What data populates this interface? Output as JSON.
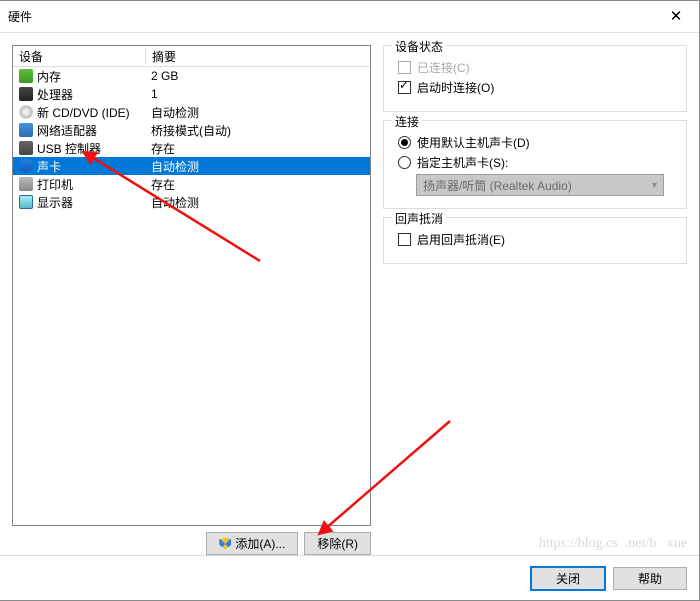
{
  "title": "硬件",
  "columns": {
    "device": "设备",
    "summary": "摘要"
  },
  "devices": [
    {
      "name": "内存",
      "summary": "2 GB",
      "icon": "icon-green",
      "selected": false
    },
    {
      "name": "处理器",
      "summary": "1",
      "icon": "icon-chip",
      "selected": false
    },
    {
      "name": "新 CD/DVD (IDE)",
      "summary": "自动检测",
      "icon": "icon-disc",
      "selected": false
    },
    {
      "name": "网络适配器",
      "summary": "桥接模式(自动)",
      "icon": "icon-net",
      "selected": false
    },
    {
      "name": "USB 控制器",
      "summary": "存在",
      "icon": "icon-usb",
      "selected": false
    },
    {
      "name": "声卡",
      "summary": "自动检测",
      "icon": "icon-sound",
      "selected": true
    },
    {
      "name": "打印机",
      "summary": "存在",
      "icon": "icon-printer",
      "selected": false
    },
    {
      "name": "显示器",
      "summary": "自动检测",
      "icon": "icon-monitor",
      "selected": false
    }
  ],
  "buttons": {
    "add": "添加(A)...",
    "remove": "移除(R)"
  },
  "groups": {
    "device_status": {
      "legend": "设备状态",
      "connected": {
        "label": "已连接(C)",
        "checked": false,
        "enabled": false
      },
      "connect_at_poweron": {
        "label": "启动时连接(O)",
        "checked": true
      }
    },
    "connection": {
      "legend": "连接",
      "use_default": {
        "label": "使用默认主机声卡(D)",
        "selected": true
      },
      "specify": {
        "label": "指定主机声卡(S):",
        "selected": false
      },
      "combo_value": "扬声器/听筒 (Realtek Audio)"
    },
    "echo": {
      "legend": "回声抵消",
      "enable": {
        "label": "启用回声抵消(E)",
        "checked": false
      }
    }
  },
  "footer": {
    "close": "关闭",
    "help": "帮助"
  }
}
